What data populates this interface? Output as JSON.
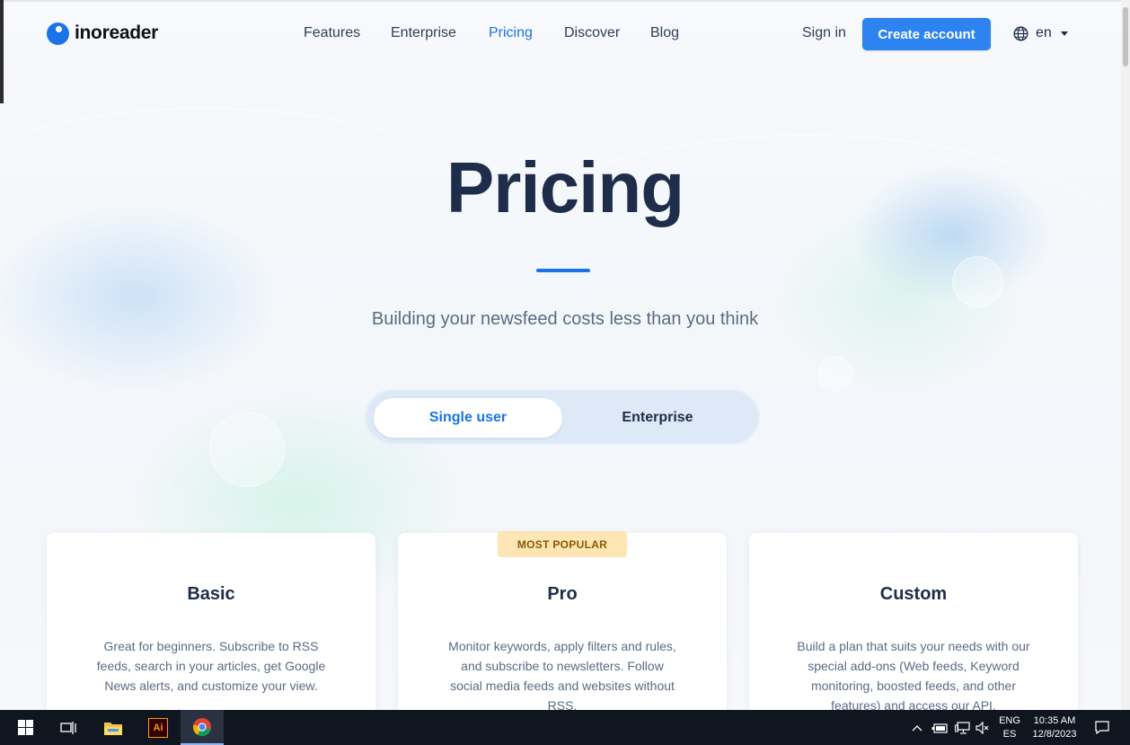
{
  "header": {
    "logo_text": "inoreader",
    "nav": [
      {
        "label": "Features",
        "active": false
      },
      {
        "label": "Enterprise",
        "active": false
      },
      {
        "label": "Pricing",
        "active": true
      },
      {
        "label": "Discover",
        "active": false
      },
      {
        "label": "Blog",
        "active": false
      }
    ],
    "sign_in": "Sign in",
    "create_account": "Create account",
    "language": "en"
  },
  "hero": {
    "title": "Pricing",
    "subtitle": "Building your newsfeed costs less than you think"
  },
  "plan_toggle": {
    "options": [
      "Single user",
      "Enterprise"
    ],
    "selected": "Single user"
  },
  "plans": [
    {
      "name": "Basic",
      "badge": "",
      "description": "Great for beginners. Subscribe to RSS feeds, search in your articles, get Google News alerts, and customize your view."
    },
    {
      "name": "Pro",
      "badge": "MOST POPULAR",
      "description": "Monitor keywords, apply filters and rules, and subscribe to newsletters. Follow social media feeds and websites without RSS."
    },
    {
      "name": "Custom",
      "badge": "",
      "description": "Build a plan that suits your needs with our special add-ons (Web feeds, Keyword monitoring, boosted feeds, and other features) and access our API."
    }
  ],
  "taskbar": {
    "apps": [
      "start-icon",
      "task-view-icon",
      "file-explorer-icon",
      "illustrator-icon",
      "chrome-icon"
    ],
    "lang_top": "ENG",
    "lang_bottom": "ES",
    "time": "10:35 AM",
    "date": "12/8/2023"
  },
  "colors": {
    "accent": "#1b73e8",
    "button": "#2d83ef",
    "heading": "#1e2d4a",
    "badge_bg": "#fde6b3"
  }
}
